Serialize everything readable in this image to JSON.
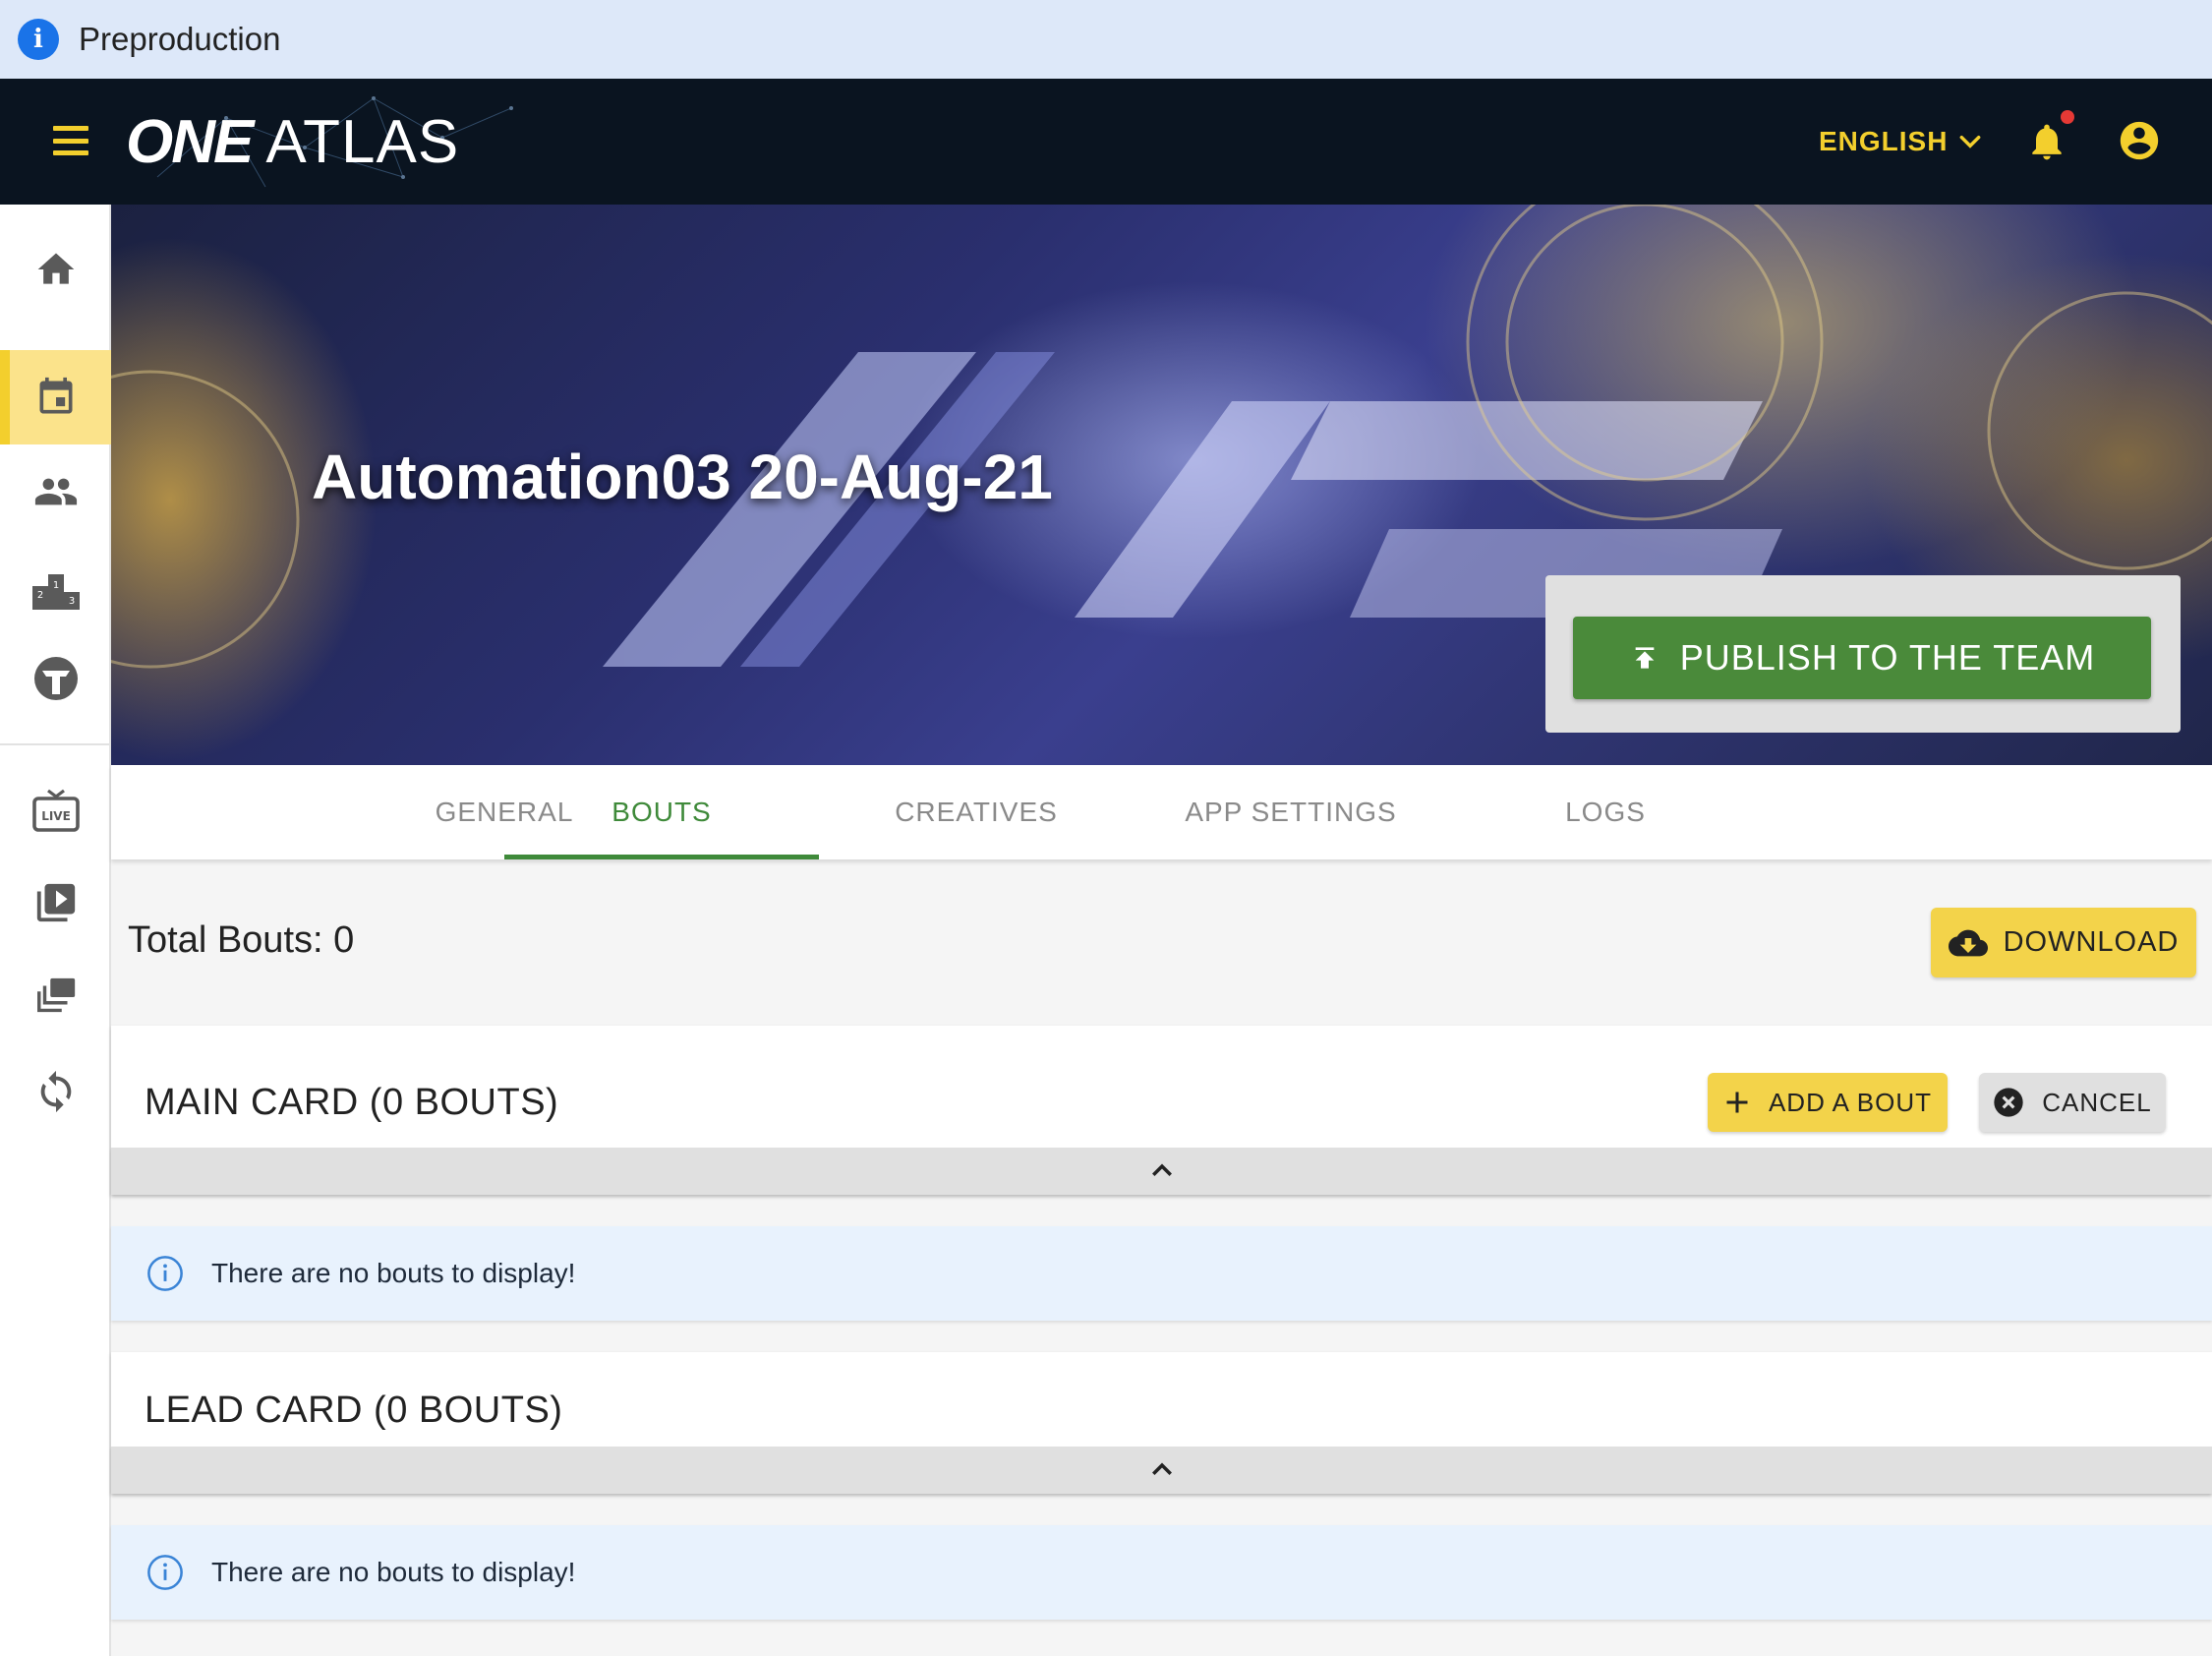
{
  "environment": {
    "label": "Preproduction",
    "icon": "info-icon"
  },
  "appbar": {
    "logo_one": "ONE",
    "logo_atlas": "ATLAS",
    "language": "ENGLISH",
    "icons": [
      "menu-icon",
      "chevron-down-icon",
      "bell-icon",
      "account-icon"
    ]
  },
  "sidebar": {
    "items": [
      {
        "name": "home",
        "icon": "home-icon"
      },
      {
        "name": "events",
        "icon": "calendar-icon",
        "active": true
      },
      {
        "name": "athletes",
        "icon": "people-icon"
      },
      {
        "name": "rankings",
        "icon": "podium-icon"
      },
      {
        "name": "brand",
        "icon": "one-brand-icon"
      },
      {
        "name": "live",
        "icon": "live-tv-icon"
      },
      {
        "name": "videos",
        "icon": "video-library-icon"
      },
      {
        "name": "collections",
        "icon": "collections-icon"
      },
      {
        "name": "sync",
        "icon": "sync-icon"
      }
    ]
  },
  "event": {
    "title": "Automation03 20-Aug-21"
  },
  "publish": {
    "label": "PUBLISH TO THE TEAM",
    "icon": "publish-icon"
  },
  "tabs": [
    {
      "label": "GENERAL"
    },
    {
      "label": "BOUTS",
      "active": true
    },
    {
      "label": "CREATIVES"
    },
    {
      "label": "APP SETTINGS"
    },
    {
      "label": "LOGS"
    }
  ],
  "toolbar": {
    "total_bouts": "Total Bouts: 0",
    "download_label": "DOWNLOAD",
    "download_icon": "cloud-download-icon"
  },
  "main_card": {
    "title": "MAIN CARD (0 BOUTS)",
    "add_label": "ADD A BOUT",
    "cancel_label": "CANCEL",
    "empty_message": "There are no bouts to display!"
  },
  "lead_card": {
    "title": "LEAD CARD (0 BOUTS)",
    "empty_message": "There are no bouts to display!"
  },
  "colors": {
    "accent_yellow": "#f3cf2d",
    "appbar_bg": "#0a1420",
    "publish_green": "#4a8a3a",
    "active_tab_green": "#3f8a3a",
    "info_bg": "#e8f2fd"
  }
}
